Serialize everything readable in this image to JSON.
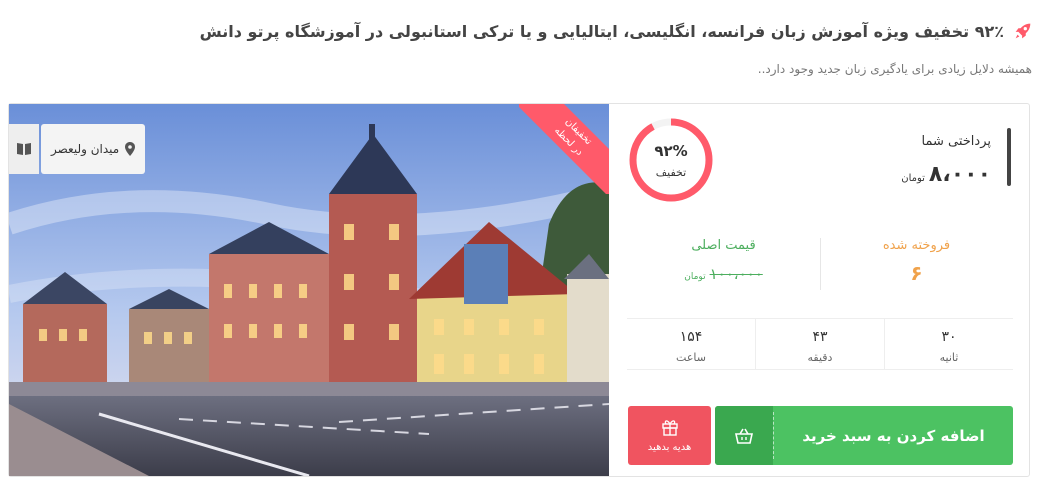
{
  "header": {
    "title": "۹۲٪ تخفیف ویژه آموزش زبان فرانسه، انگلیسی، ایتالیایی و یا ترکی استانبولی در آموزشگاه پرتو دانش",
    "subtitle": "همیشه دلایل زیادی برای یادگیری زبان جدید وجود دارد..",
    "icon": "rocket-icon",
    "accent_color": "#ff5a6a"
  },
  "photo": {
    "location_label": "میدان ولیعصر",
    "location_icon": "map-pin-icon",
    "book_icon": "book-icon",
    "ribbon_line1": "تخفیفان",
    "ribbon_line2": "در لحظه"
  },
  "pricing": {
    "pay_label": "پرداختی شما",
    "pay_amount": "۸،۰۰۰",
    "pay_unit": "تومان",
    "discount_percent": "۹۲%",
    "discount_value": 92,
    "discount_label": "تخفیف",
    "sold_label": "فروخته شده",
    "sold_count": "۶",
    "original_label": "قیمت اصلی",
    "original_amount": "۱۰۰،۰۰۰",
    "original_unit": "تومان"
  },
  "timer": {
    "seconds_value": "۳۰",
    "seconds_label": "ثانیه",
    "minutes_value": "۴۳",
    "minutes_label": "دقیقه",
    "hours_value": "۱۵۴",
    "hours_label": "ساعت"
  },
  "actions": {
    "add_to_cart_label": "اضافه کردن به سبد خرید",
    "gift_label": "هدیه بدهید",
    "cart_icon": "basket-icon",
    "gift_icon": "gift-icon"
  },
  "colors": {
    "green": "#4cc262",
    "orange": "#f0a24b",
    "red": "#f05460"
  }
}
